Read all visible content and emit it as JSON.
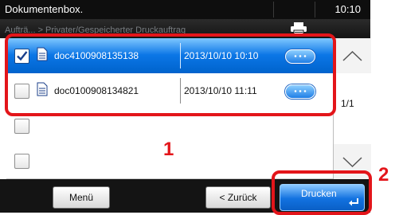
{
  "header": {
    "title": "Dokumentenbox.",
    "time": "10:10"
  },
  "breadcrumb": {
    "path": "Aufträ... > Privater/Gespeicherter Druckauftrag"
  },
  "files": [
    {
      "name": "doc4100908135138",
      "date": "2013/10/10 10:10",
      "selected": true
    },
    {
      "name": "doc0100908134821",
      "date": "2013/10/10 11:11",
      "selected": false
    },
    {
      "name": "",
      "date": "",
      "selected": false
    },
    {
      "name": "",
      "date": "",
      "selected": false
    }
  ],
  "pagination": {
    "indicator": "1/1"
  },
  "toolbar": {
    "menu_label": "Menü",
    "back_label": "< Zurück",
    "print_label": "Drucken"
  },
  "annotations": {
    "label_1": "1",
    "label_2": "2"
  },
  "colors": {
    "annotation": "#e3151a",
    "selection": "#0b76e6"
  }
}
